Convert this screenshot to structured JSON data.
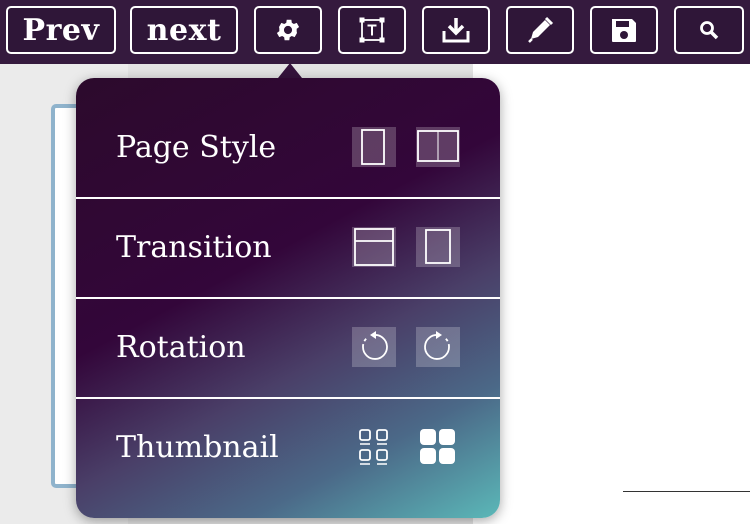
{
  "toolbar": {
    "prev_label": "Prev",
    "next_label": "next",
    "icons": [
      "gear-icon",
      "text-box-icon",
      "download-icon",
      "pen-icon",
      "save-icon",
      "search-icon"
    ]
  },
  "settings_menu": {
    "rows": [
      {
        "label": "Page Style",
        "options": [
          "single-page-icon",
          "two-page-icon"
        ]
      },
      {
        "label": "Transition",
        "options": [
          "slide-vertical-icon",
          "slide-horizontal-icon"
        ]
      },
      {
        "label": "Rotation",
        "options": [
          "rotate-counterclockwise-icon",
          "rotate-clockwise-icon"
        ]
      },
      {
        "label": "Thumbnail",
        "options": [
          "small-thumbnails-icon",
          "large-thumbnails-icon"
        ]
      }
    ]
  },
  "colors": {
    "toolbar_bg": "#351a3e",
    "menu_gradient_start": "#2c0a2c",
    "menu_gradient_end": "#5bb8b8",
    "thumbnail_border": "#8fb3cc"
  }
}
